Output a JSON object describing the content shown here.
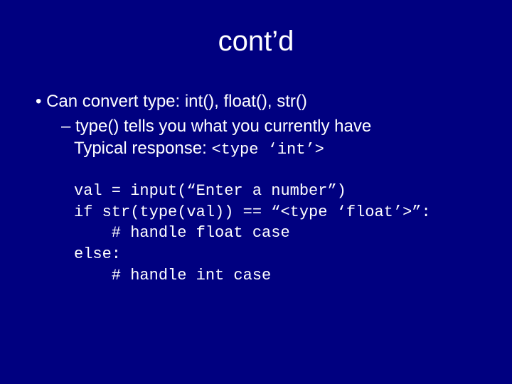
{
  "title": "cont’d",
  "b1": "Can convert type:  int(),  float(),  str()",
  "b2": "type() tells you what you currently have",
  "b3a": "Typical response: ",
  "b3b": "<type ‘int’>",
  "code": "val = input(“Enter a number”)\nif str(type(val)) == “<type ‘float’>”:\n    # handle float case\nelse:\n    # handle int case"
}
